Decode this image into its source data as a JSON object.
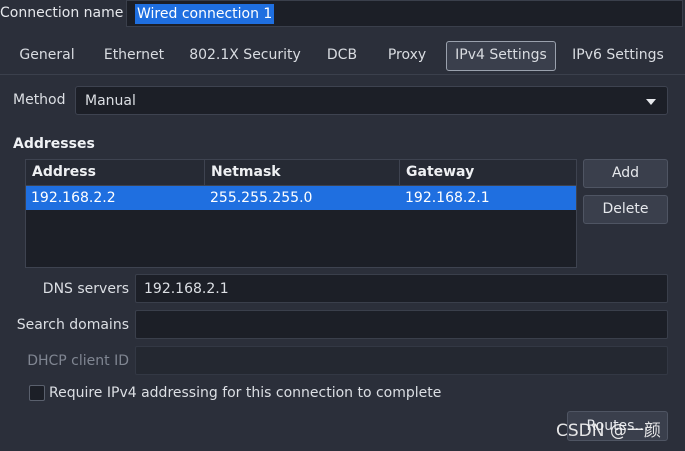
{
  "header": {
    "connection_label": "Connection name",
    "connection_value": "Wired connection 1"
  },
  "tabs": [
    {
      "label": "General",
      "active": false
    },
    {
      "label": "Ethernet",
      "active": false
    },
    {
      "label": "802.1X Security",
      "active": false
    },
    {
      "label": "DCB",
      "active": false
    },
    {
      "label": "Proxy",
      "active": false
    },
    {
      "label": "IPv4 Settings",
      "active": true
    },
    {
      "label": "IPv6 Settings",
      "active": false
    }
  ],
  "method": {
    "label": "Method",
    "value": "Manual"
  },
  "addresses": {
    "title": "Addresses",
    "columns": [
      "Address",
      "Netmask",
      "Gateway"
    ],
    "rows": [
      [
        "192.168.2.2",
        "255.255.255.0",
        "192.168.2.1"
      ]
    ],
    "add_label": "Add",
    "delete_label": "Delete"
  },
  "dns": {
    "label": "DNS servers",
    "value": "192.168.2.1"
  },
  "search_domains": {
    "label": "Search domains",
    "value": ""
  },
  "dhcp_client_id": {
    "label": "DHCP client ID",
    "value": ""
  },
  "require_ipv4": {
    "label": "Require IPv4 addressing for this connection to complete",
    "checked": false
  },
  "routes_label": "Routes…",
  "watermark": "CSDN @一颜",
  "colors": {
    "background": "#2b2f3a",
    "selection": "#1f6fe0",
    "field": "#1c1f27"
  }
}
